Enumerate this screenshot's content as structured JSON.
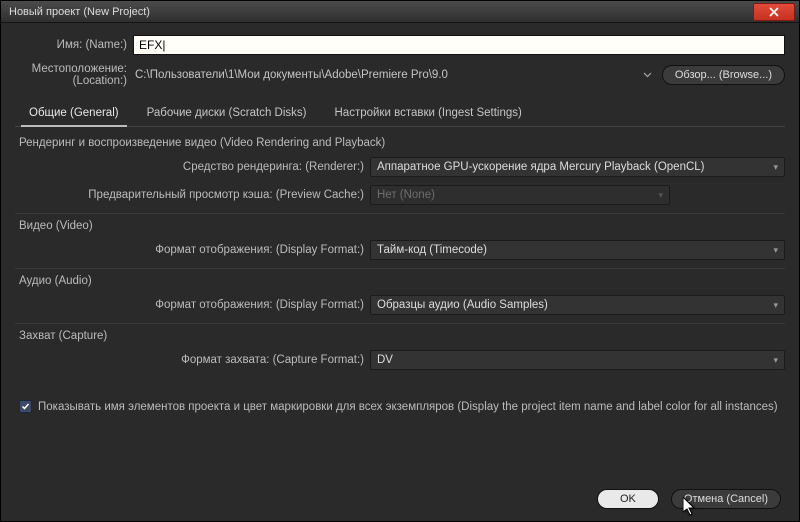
{
  "title": "Новый проект (New Project)",
  "name_label": "Имя: (Name:)",
  "name_value": "EFX|",
  "location_label": "Местоположение: (Location:)",
  "location_value": "C:\\Пользователи\\1\\Мои документы\\Adobe\\Premiere Pro\\9.0",
  "browse_label": "Обзор... (Browse...)",
  "tabs": {
    "general": "Общие (General)",
    "scratch": "Рабочие диски (Scratch Disks)",
    "ingest": "Настройки вставки (Ingest Settings)"
  },
  "sec_render": "Рендеринг и воспроизведение видео (Video Rendering and Playback)",
  "renderer_label": "Средство рендеринга: (Renderer:)",
  "renderer_value": "Аппаратное GPU-ускорение ядра Mercury Playback (OpenCL)",
  "preview_label": "Предварительный просмотр кэша: (Preview Cache:)",
  "preview_value": "Нет (None)",
  "sec_video": "Видео (Video)",
  "display_format_label": "Формат отображения: (Display Format:)",
  "video_display_value": "Тайм-код (Timecode)",
  "sec_audio": "Аудио (Audio)",
  "audio_display_value": "Образцы аудио (Audio Samples)",
  "sec_capture": "Захват (Capture)",
  "capture_format_label": "Формат захвата: (Capture Format:)",
  "capture_format_value": "DV",
  "show_item_name_label": "Показывать имя элементов проекта и цвет маркировки для всех экземпляров (Display the project item name and label color for all instances)",
  "ok_label": "OK",
  "cancel_label": "Отмена (Cancel)"
}
